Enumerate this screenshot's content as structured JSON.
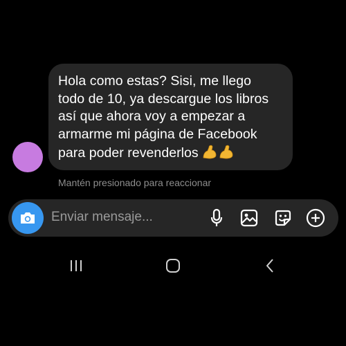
{
  "conversation": {
    "message_lines": [
      "Hola como estas? Sisi, me llego",
      "todo de 10, ya descargue los libros",
      "así que ahora voy a empezar a",
      "armarme mi página de Facebook",
      "para poder revenderlos"
    ],
    "message_emoji": "💪💪",
    "react_hint": "Mantén presionado para reaccionar",
    "avatar_color": "#c77be0"
  },
  "composer": {
    "placeholder": "Enviar mensaje...",
    "icons": [
      "camera-icon",
      "microphone-icon",
      "gallery-icon",
      "sticker-icon",
      "add-icon"
    ],
    "accent_color": "#3797f0"
  },
  "system_nav": {
    "buttons": [
      "recent-apps-icon",
      "home-icon",
      "back-icon"
    ]
  }
}
